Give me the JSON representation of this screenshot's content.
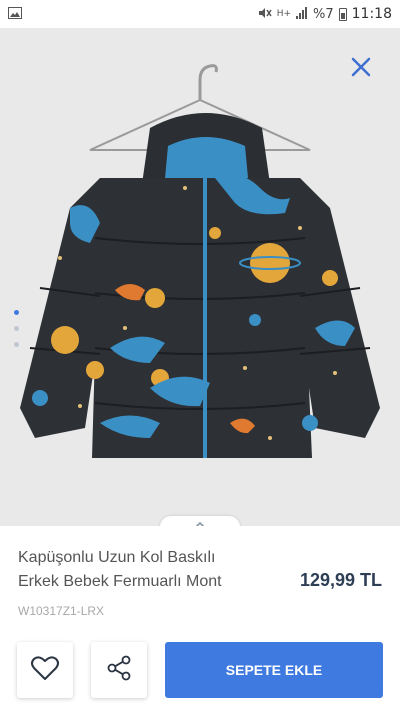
{
  "status_bar": {
    "time": "11:18",
    "battery": "%7",
    "network": "H+"
  },
  "product": {
    "title_line1": "Kapüşonlu Uzun Kol Baskılı",
    "title_line2": "Erkek Bebek Fermuarlı Mont",
    "price": "129,99 TL",
    "sku": "W10317Z1-LRX"
  },
  "actions": {
    "add_to_cart": "SEPETE EKLE"
  },
  "gallery": {
    "image_count": 3,
    "active_index": 0
  },
  "colors": {
    "accent": "#3f7ae0",
    "price": "#2e3e55"
  }
}
